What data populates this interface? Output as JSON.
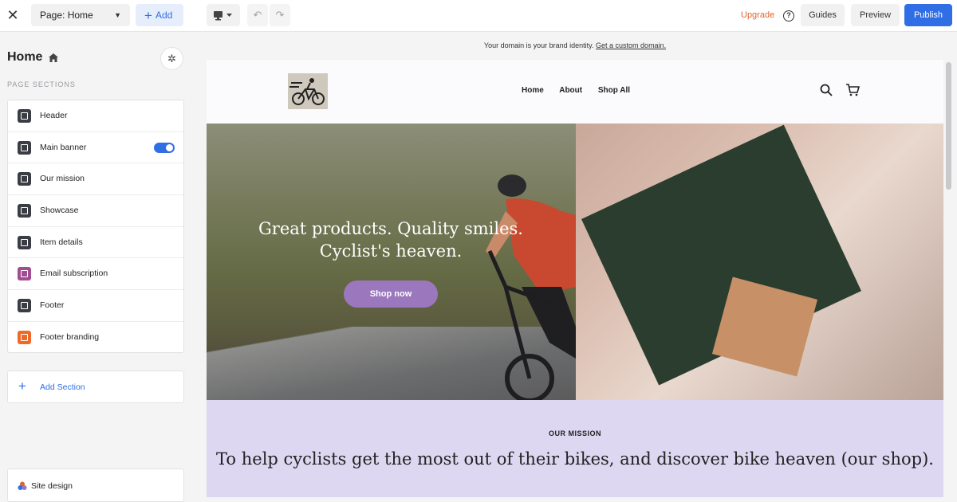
{
  "topbar": {
    "page_select": "Page: Home",
    "add_label": "Add",
    "upgrade_label": "Upgrade",
    "guides_label": "Guides",
    "preview_label": "Preview",
    "publish_label": "Publish",
    "accent_color": "#2f6ee5",
    "upgrade_color": "#e0662e"
  },
  "sidebar": {
    "title": "Home",
    "caption": "PAGE SECTIONS",
    "sections": [
      {
        "label": "Header",
        "icon": "header-icon"
      },
      {
        "label": "Main banner",
        "icon": "bookmark-icon",
        "toggle_on": true
      },
      {
        "label": "Our mission",
        "icon": "shield-icon"
      },
      {
        "label": "Showcase",
        "icon": "showcase-icon"
      },
      {
        "label": "Item details",
        "icon": "item-details-icon"
      },
      {
        "label": "Email subscription",
        "icon": "email-icon"
      },
      {
        "label": "Footer",
        "icon": "footer-icon"
      },
      {
        "label": "Footer branding",
        "icon": "lightning-icon"
      }
    ],
    "add_section_label": "Add Section",
    "site_design_label": "Site design"
  },
  "domain_note": {
    "text": "Your domain is your brand identity.",
    "link": "Get a custom domain."
  },
  "site": {
    "nav": [
      "Home",
      "About",
      "Shop All"
    ],
    "hero_heading": "Great products. Quality smiles. Cyclist's heaven.",
    "hero_button": "Shop now",
    "mission_caption": "OUR MISSION",
    "mission_text": "To help cyclists get the most out of their bikes, and discover bike heaven (our shop).",
    "mission_bg": "#ddd7f1",
    "button_color": "#9b77bd"
  }
}
